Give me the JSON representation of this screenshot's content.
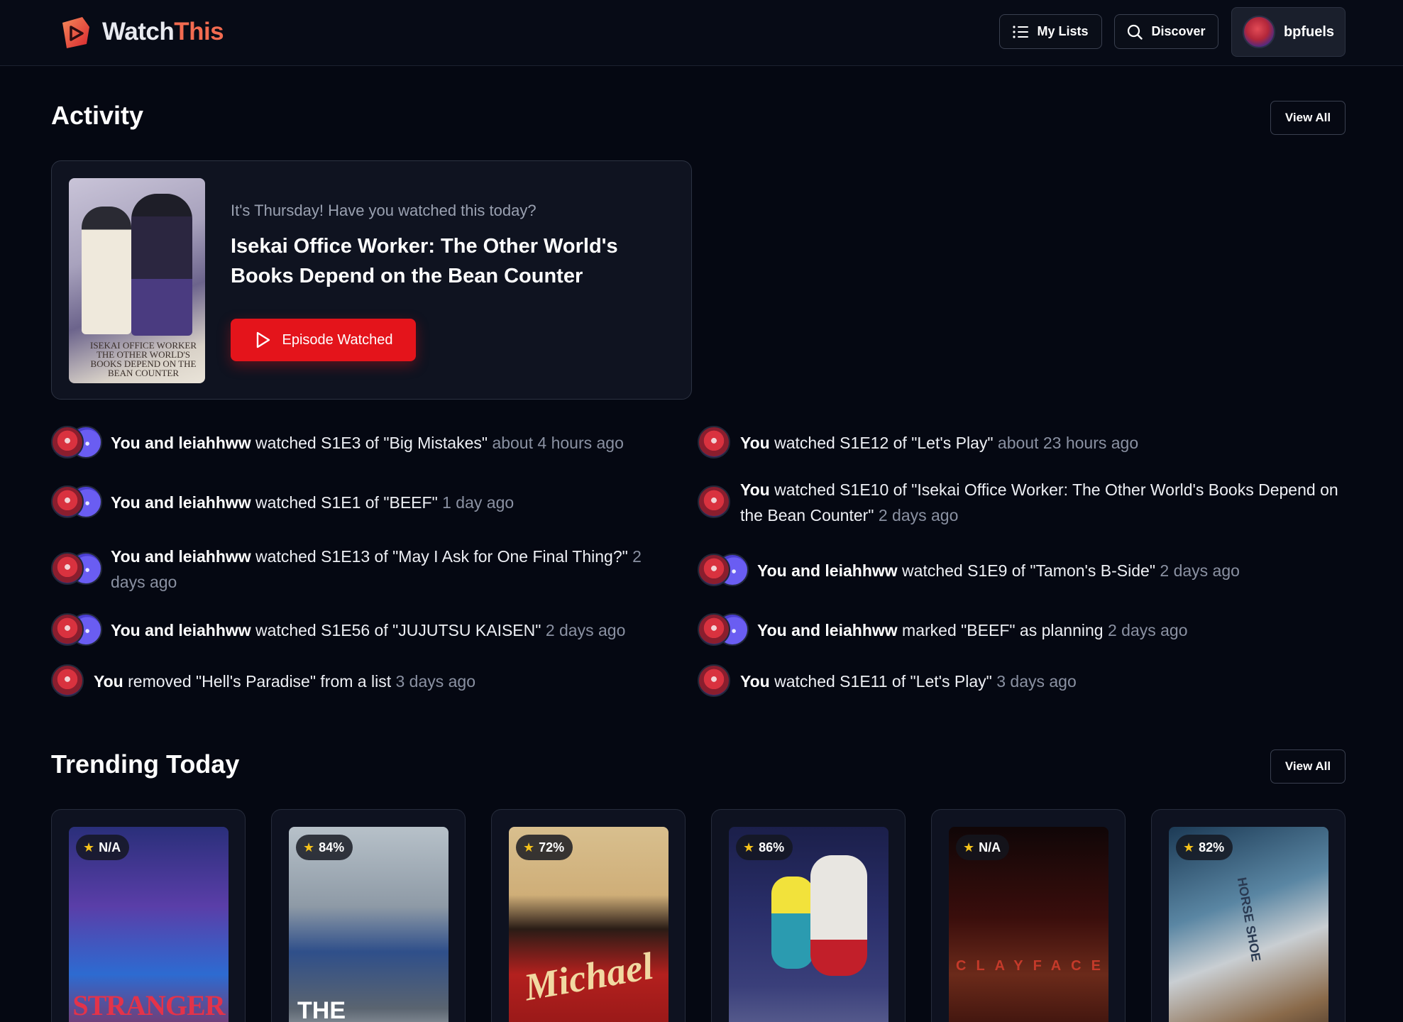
{
  "app": {
    "name_part1": "Watch",
    "name_part2": "This",
    "accent_color": "#f26b50"
  },
  "header": {
    "my_lists_label": "My Lists",
    "discover_label": "Discover",
    "username": "bpfuels",
    "icons": [
      "list-icon",
      "search-icon",
      "avatar"
    ]
  },
  "activity": {
    "title": "Activity",
    "view_all_label": "View All",
    "reminder": {
      "question": "It's Thursday! Have you watched this today?",
      "show_title": "Isekai Office Worker: The Other World's Books Depend on the Bean Counter",
      "poster_text": "Isekai Office Worker The Other World's Books Depend on the Bean Counter",
      "button_label": "Episode Watched",
      "button_color": "#e4141b"
    },
    "items": [
      {
        "actor": "You and leiahhww",
        "action": "watched S1E3 of \"Big Mistakes\"",
        "time": "about 4 hours ago"
      },
      {
        "actor": "You",
        "action": "watched S1E12 of \"Let's Play\"",
        "time": "about 23 hours ago"
      },
      {
        "actor": "You and leiahhww",
        "action": "watched S1E1 of \"BEEF\"",
        "time": "1 day ago"
      },
      {
        "actor": "You",
        "action": "watched S1E10 of \"Isekai Office Worker: The Other World's Books Depend on the Bean Counter\"",
        "time": "2 days ago"
      },
      {
        "actor": "You and leiahhww",
        "action": "watched S1E13 of \"May I Ask for One Final Thing?\"",
        "time": "2 days ago"
      },
      {
        "actor": "You and leiahhww",
        "action": "watched S1E9 of \"Tamon's B-Side\"",
        "time": "2 days ago"
      },
      {
        "actor": "You and leiahhww",
        "action": "watched S1E56 of \"JUJUTSU KAISEN\"",
        "time": "2 days ago"
      },
      {
        "actor": "You and leiahhww",
        "action": "marked \"BEEF\" as planning",
        "time": "2 days ago"
      },
      {
        "actor": "You",
        "action": "removed \"Hell's Paradise\" from a list",
        "time": "3 days ago"
      },
      {
        "actor": "You",
        "action": "watched S1E11 of \"Let's Play\"",
        "time": "3 days ago"
      }
    ]
  },
  "trending": {
    "title": "Trending Today",
    "view_all_label": "View All",
    "cards": [
      {
        "rating": "N/A",
        "poster_text": "STRANGER"
      },
      {
        "rating": "84%",
        "poster_text": "THE"
      },
      {
        "rating": "72%",
        "poster_text": "Michael"
      },
      {
        "rating": "86%",
        "poster_text": ""
      },
      {
        "rating": "N/A",
        "poster_text": "CLAYFACE"
      },
      {
        "rating": "82%",
        "poster_text": "HORSE SHOE"
      }
    ]
  }
}
